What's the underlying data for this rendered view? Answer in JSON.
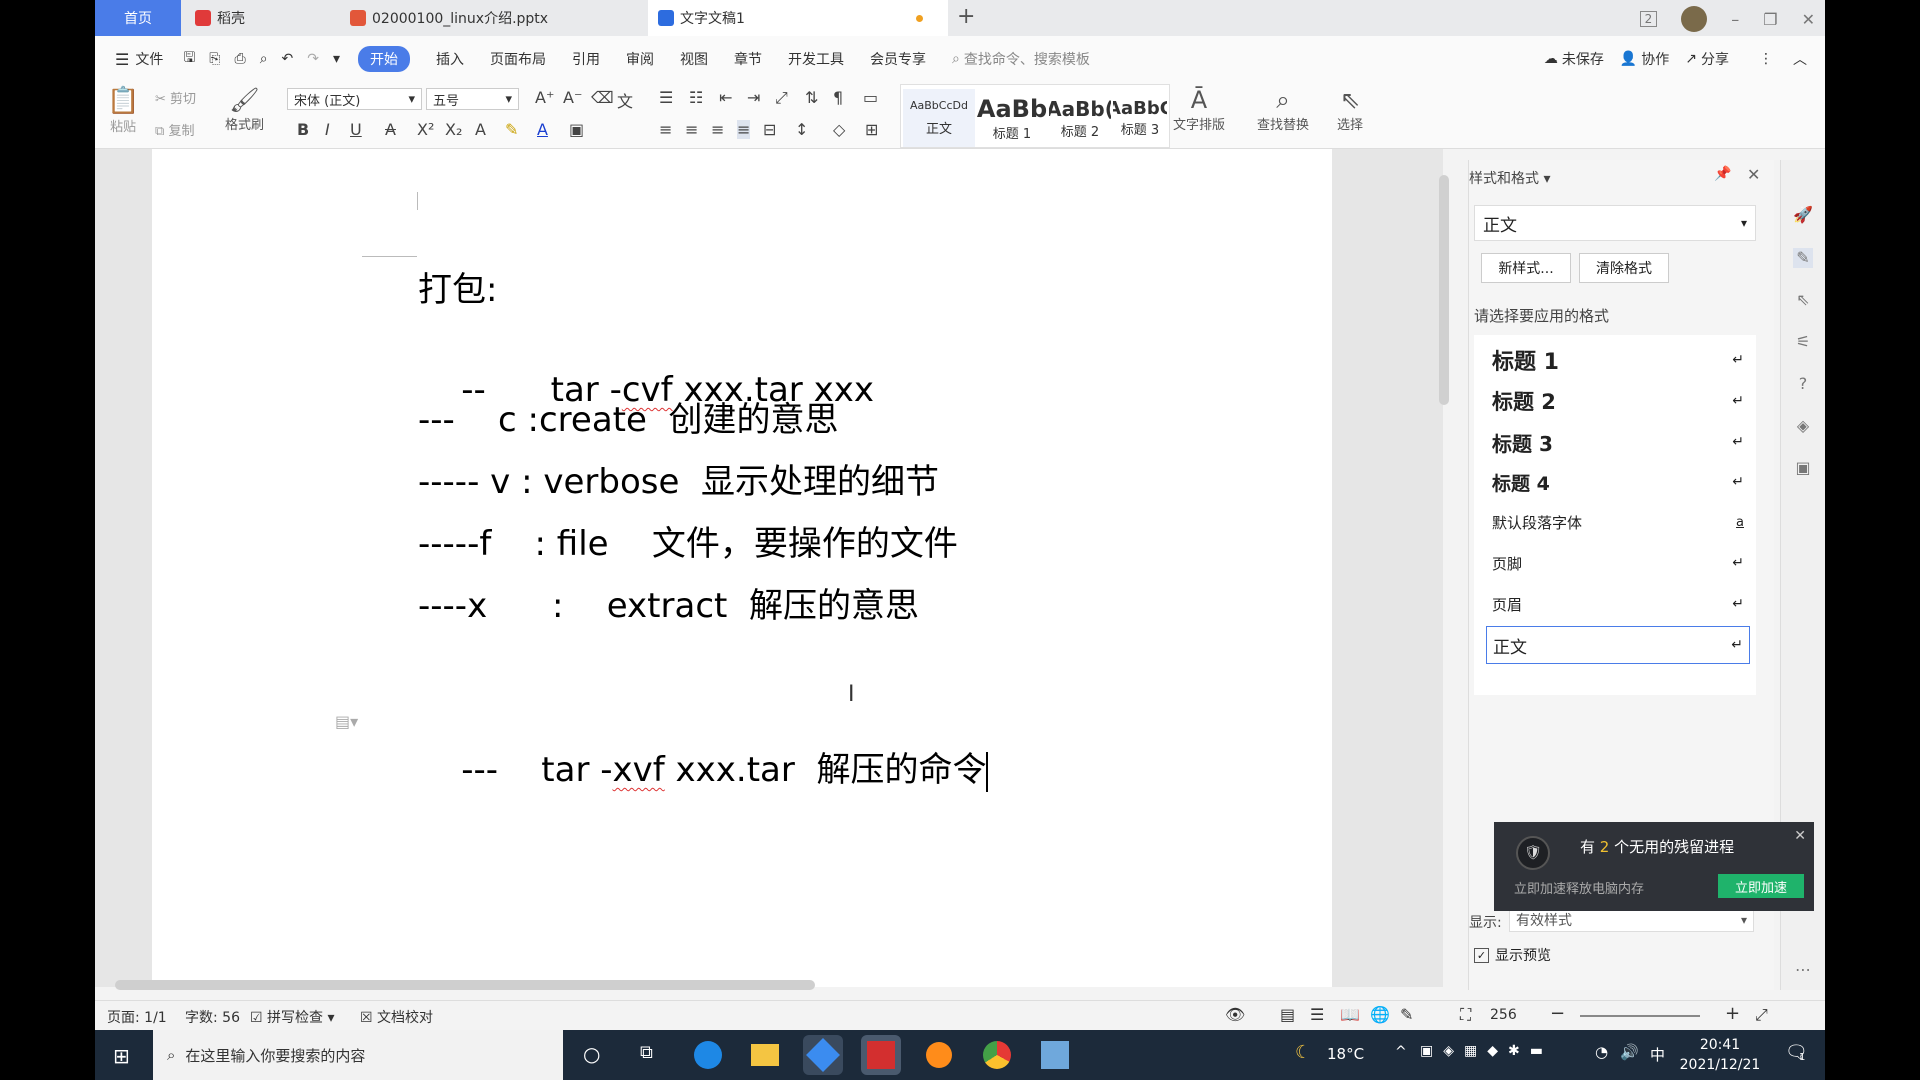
{
  "titlebar": {
    "tabs": [
      {
        "label": "首页"
      },
      {
        "label": "稻壳"
      },
      {
        "label": "02000100_linux介绍.pptx"
      },
      {
        "label": "文字文稿1"
      }
    ],
    "new_tab": "+",
    "badge": "2"
  },
  "menubar": {
    "file": "文件",
    "items": [
      "开始",
      "插入",
      "页面布局",
      "引用",
      "审阅",
      "视图",
      "章节",
      "开发工具",
      "会员专享"
    ],
    "search_placeholder": "查找命令、搜索模板",
    "unsaved": "未保存",
    "collab": "协作",
    "share": "分享"
  },
  "ribbon": {
    "paste": "粘贴",
    "cut": "剪切",
    "copy": "复制",
    "format_painter": "格式刷",
    "font_name": "宋体 (正文)",
    "font_size": "五号",
    "styles": [
      {
        "preview": "AaBbCcDd",
        "label": "正文"
      },
      {
        "preview": "AaBb",
        "label": "标题 1"
      },
      {
        "preview": "AaBb(",
        "label": "标题 2"
      },
      {
        "preview": "AaBbC",
        "label": "标题 3"
      }
    ],
    "text_layout": "文字排版",
    "find_replace": "查找替换",
    "select": "选择"
  },
  "document": {
    "lines": [
      {
        "text": "打包:"
      },
      {
        "prefix": "--      ",
        "cmd": "tar -",
        "squig": "cvf",
        "rest": " xxx.tar xxx"
      },
      {
        "text": "---    c :create  创建的意思"
      },
      {
        "text": "----- v : verbose  显示处理的细节"
      },
      {
        "text": "-----f    : file    文件，要操作的文件"
      },
      {
        "text": "----x      :    extract  解压的意思"
      },
      {
        "prefix": "---    ",
        "cmd": "tar -",
        "squig": "xvf",
        "rest": " xxx.tar  解压的命令"
      }
    ]
  },
  "panel": {
    "title": "样式和格式",
    "current_style": "正文",
    "new_style": "新样式...",
    "clear_format": "清除格式",
    "apply_prompt": "请选择要应用的格式",
    "styles": [
      {
        "label": "标题  1",
        "mark": "↵"
      },
      {
        "label": "标题  2",
        "mark": "↵"
      },
      {
        "label": "标题  3",
        "mark": "↵"
      },
      {
        "label": "标题  4",
        "mark": "↵"
      },
      {
        "label": "默认段落字体",
        "mark": "a"
      },
      {
        "label": "页脚",
        "mark": "↵"
      },
      {
        "label": "页眉",
        "mark": "↵"
      },
      {
        "label": "正文",
        "mark": "↵"
      }
    ],
    "show_label": "显示:",
    "show_value": "有效样式",
    "show_preview": "显示预览"
  },
  "popup": {
    "prefix": "有 ",
    "count": "2",
    "suffix": " 个无用的残留进程",
    "sub": "立即加速释放电脑内存",
    "button": "立即加速"
  },
  "statusbar": {
    "page": "页面: 1/1",
    "words": "字数: 56",
    "spell": "拼写检查",
    "proof": "文档校对",
    "zoom": "256"
  },
  "taskbar": {
    "search": "在这里输入你要搜索的内容",
    "temp": "18°C",
    "ime": "中",
    "time": "20:41",
    "date": "2021/12/21",
    "notif": "1"
  },
  "colors": {
    "accent": "#4a7ce8",
    "popup_bg": "#2f3238",
    "popup_button": "#1fb36b"
  }
}
